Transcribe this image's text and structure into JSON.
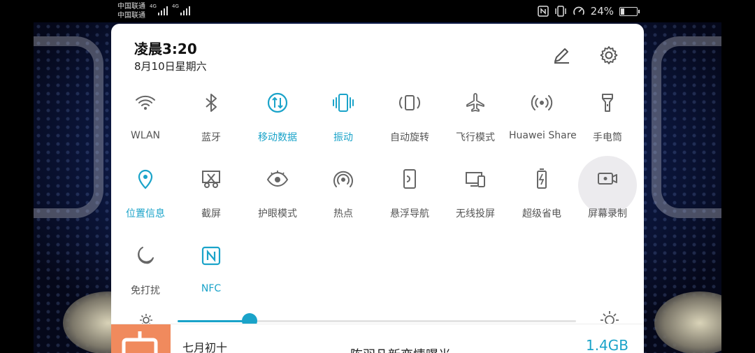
{
  "status_bar": {
    "carrier_1": "中国联通",
    "carrier_2": "中国联通",
    "network_1": "4G",
    "network_2": "4G",
    "battery_percent": "24%",
    "battery_level": 0.24
  },
  "header": {
    "time": "凌晨3:20",
    "date": "8月10日星期六"
  },
  "tiles": [
    {
      "label": "WLAN",
      "icon": "wifi-icon",
      "active": false
    },
    {
      "label": "蓝牙",
      "icon": "bluetooth-icon",
      "active": false
    },
    {
      "label": "移动数据",
      "icon": "mobile-data-icon",
      "active": true
    },
    {
      "label": "振动",
      "icon": "vibrate-icon",
      "active": true
    },
    {
      "label": "自动旋转",
      "icon": "auto-rotate-icon",
      "active": false
    },
    {
      "label": "飞行模式",
      "icon": "airplane-icon",
      "active": false
    },
    {
      "label": "Huawei Share",
      "icon": "huawei-share-icon",
      "active": false
    },
    {
      "label": "手电筒",
      "icon": "flashlight-icon",
      "active": false
    },
    {
      "label": "位置信息",
      "icon": "location-icon",
      "active": true
    },
    {
      "label": "截屏",
      "icon": "screenshot-icon",
      "active": false
    },
    {
      "label": "护眼模式",
      "icon": "eye-comfort-icon",
      "active": false
    },
    {
      "label": "热点",
      "icon": "hotspot-icon",
      "active": false
    },
    {
      "label": "悬浮导航",
      "icon": "floating-nav-icon",
      "active": false
    },
    {
      "label": "无线投屏",
      "icon": "wireless-projection-icon",
      "active": false
    },
    {
      "label": "超级省电",
      "icon": "power-saving-icon",
      "active": false
    },
    {
      "label": "屏幕录制",
      "icon": "screen-record-icon",
      "active": false
    },
    {
      "label": "免打扰",
      "icon": "do-not-disturb-icon",
      "active": false
    },
    {
      "label": "NFC",
      "icon": "nfc-icon",
      "active": true
    }
  ],
  "brightness": {
    "level": 0.18
  },
  "notification": {
    "lunar_date": "七月初十",
    "headline": "陈羽凡新恋情曝光",
    "size": "1.4GB"
  },
  "colors": {
    "accent": "#1aa3c9",
    "icon_inactive": "#555555",
    "panel_bg": "#ffffff"
  }
}
